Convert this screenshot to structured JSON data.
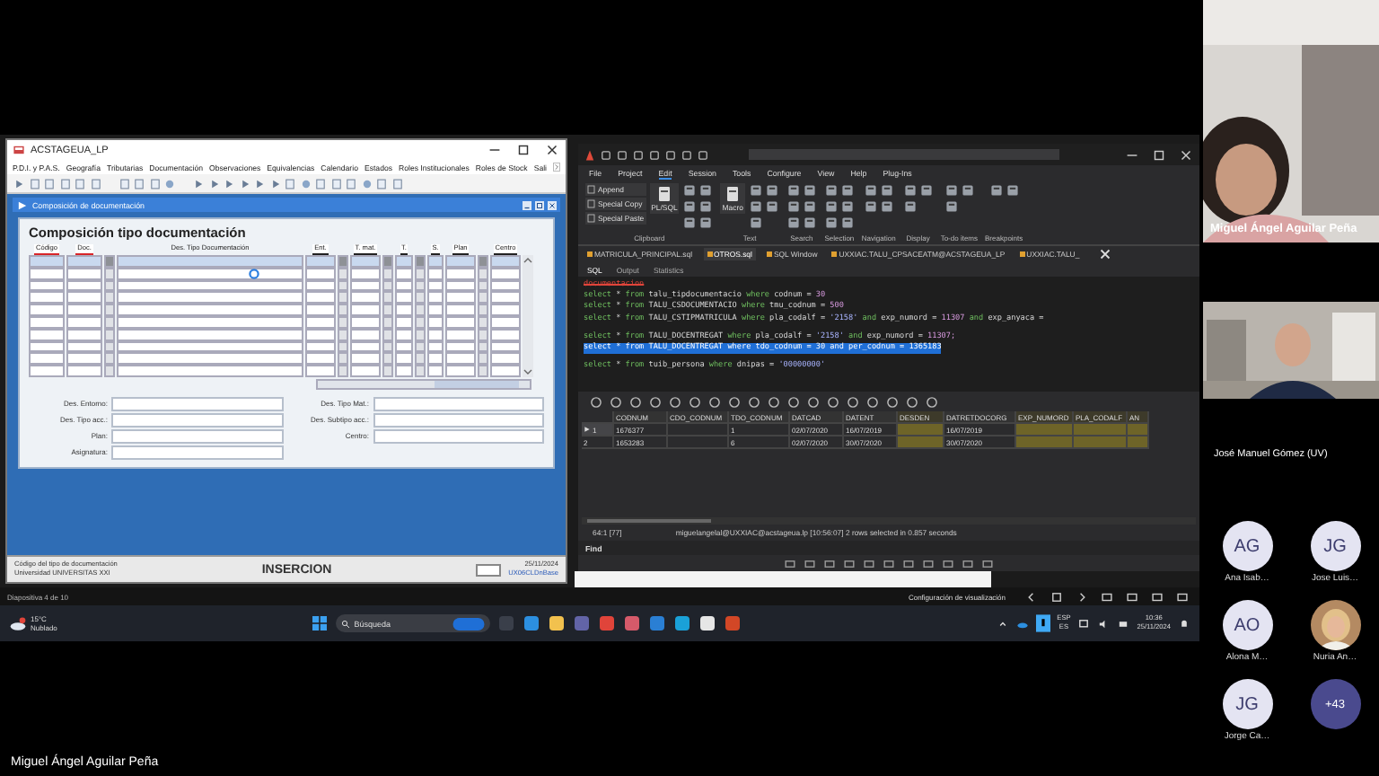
{
  "forms_window": {
    "title": "ACSTAGEUA_LP",
    "menu": [
      "P.D.I. y P.A.S.",
      "Geografía",
      "Tributarias",
      "Documentación",
      "Observaciones",
      "Equivalencias",
      "Calendario",
      "Estados",
      "Roles Institucionales",
      "Roles de Stock",
      "Sali"
    ],
    "form_title": "Composición de documentación",
    "heading": "Composición tipo documentación",
    "columns": [
      {
        "kind": "key",
        "label": "Código"
      },
      {
        "kind": "key",
        "label": "Doc."
      },
      {
        "kind": "flag"
      },
      {
        "kind": "desc",
        "label": "Des. Tipo Documentación"
      },
      {
        "kind": "field",
        "label": "Ent."
      },
      {
        "kind": "flag"
      },
      {
        "kind": "field",
        "label": "T. mat."
      },
      {
        "kind": "flag"
      },
      {
        "kind": "field",
        "label": "T."
      },
      {
        "kind": "flag"
      },
      {
        "kind": "field",
        "label": "S."
      },
      {
        "kind": "field",
        "label": "Plan"
      },
      {
        "kind": "flag"
      },
      {
        "kind": "field",
        "label": "Centro"
      }
    ],
    "fields": [
      {
        "label": "Des. Entorno:"
      },
      {
        "label": "Des. Tipo Mat.:"
      },
      {
        "label": "Des. Tipo acc.:"
      },
      {
        "label": "Des. Subtipo acc.:"
      },
      {
        "label": "Plan:"
      },
      {
        "label": "Centro:"
      },
      {
        "label": "Asignatura:"
      }
    ],
    "status": {
      "hint": "Código del tipo de documentación",
      "institution": "Universidad UNIVERSITAS XXI",
      "mode": "INSERCION",
      "date": "25/11/2024",
      "connection": "UX06CLDnBase"
    }
  },
  "sql_window": {
    "menu": [
      {
        "label": "File",
        "selected": false
      },
      {
        "label": "Project",
        "selected": false
      },
      {
        "label": "Edit",
        "selected": true
      },
      {
        "label": "Session",
        "selected": false
      },
      {
        "label": "Tools",
        "selected": false
      },
      {
        "label": "Configure",
        "selected": false
      },
      {
        "label": "View",
        "selected": false
      },
      {
        "label": "Help",
        "selected": false
      },
      {
        "label": "Plug-Ins",
        "selected": false
      }
    ],
    "ribbon": [
      {
        "label": "Clipboard",
        "buttons": [
          "Append",
          "Special Copy",
          "Special Paste"
        ],
        "big_button": "PL/SQL"
      },
      {
        "label": "Text",
        "big_button": "Macro"
      },
      {
        "label": "Search"
      },
      {
        "label": "Selection"
      },
      {
        "label": "Navigation"
      },
      {
        "label": "Display"
      },
      {
        "label": "To-do items"
      },
      {
        "label": "Breakpoints"
      }
    ],
    "tabs": [
      {
        "label": "MATRICULA_PRINCIPAL.sql",
        "selected": false
      },
      {
        "label": "OTROS.sql",
        "selected": true
      },
      {
        "label": "SQL Window",
        "selected": false
      },
      {
        "label": "UXXIAC.TALU_CPSACEATM@ACSTAGEUA_LP",
        "selected": false
      },
      {
        "label": "UXXIAC.TALU_",
        "selected": false
      }
    ],
    "subtabs": [
      {
        "label": "SQL",
        "selected": true
      },
      {
        "label": "Output",
        "selected": false
      },
      {
        "label": "Statistics",
        "selected": false
      }
    ],
    "editor_lines": [
      {
        "selected": false,
        "gap_before": false,
        "tokens": [
          {
            "kind": "comment",
            "text": "documentacion"
          }
        ]
      },
      {
        "selected": false,
        "gap_before": false,
        "tokens": [
          {
            "kind": "kw",
            "text": "select"
          },
          {
            "kind": "op",
            "text": "*"
          },
          {
            "kind": "kw",
            "text": "from"
          },
          {
            "kind": "id",
            "text": "talu_tipdocumentacio"
          },
          {
            "kind": "kw",
            "text": "where"
          },
          {
            "kind": "id",
            "text": "codnum"
          },
          {
            "kind": "op",
            "text": "="
          },
          {
            "kind": "num",
            "text": "30"
          }
        ]
      },
      {
        "selected": false,
        "gap_before": false,
        "tokens": [
          {
            "kind": "kw",
            "text": "select"
          },
          {
            "kind": "op",
            "text": "*"
          },
          {
            "kind": "kw",
            "text": "from"
          },
          {
            "kind": "id",
            "text": "TALU_CSDOCUMENTACIO"
          },
          {
            "kind": "kw",
            "text": "where"
          },
          {
            "kind": "id",
            "text": "tmu_codnum"
          },
          {
            "kind": "op",
            "text": "="
          },
          {
            "kind": "num",
            "text": "500"
          }
        ]
      },
      {
        "selected": false,
        "gap_before": false,
        "tokens": [
          {
            "kind": "kw",
            "text": "select"
          },
          {
            "kind": "op",
            "text": "*"
          },
          {
            "kind": "kw",
            "text": "from"
          },
          {
            "kind": "id",
            "text": "TALU_CSTIPMATRICULA"
          },
          {
            "kind": "kw",
            "text": "where"
          },
          {
            "kind": "id",
            "text": "pla_codalf"
          },
          {
            "kind": "op",
            "text": "="
          },
          {
            "kind": "str",
            "text": "'2158'"
          },
          {
            "kind": "kw",
            "text": "and"
          },
          {
            "kind": "id",
            "text": "exp_numord"
          },
          {
            "kind": "op",
            "text": "="
          },
          {
            "kind": "num",
            "text": "11307"
          },
          {
            "kind": "kw",
            "text": "and"
          },
          {
            "kind": "id",
            "text": "exp_anyaca"
          },
          {
            "kind": "op",
            "text": "="
          }
        ]
      },
      {
        "selected": false,
        "gap_before": true,
        "tokens": [
          {
            "kind": "kw",
            "text": "select"
          },
          {
            "kind": "op",
            "text": "*"
          },
          {
            "kind": "kw",
            "text": "from"
          },
          {
            "kind": "id",
            "text": "TALU_DOCENTREGAT"
          },
          {
            "kind": "kw",
            "text": "where"
          },
          {
            "kind": "id",
            "text": "pla_codalf"
          },
          {
            "kind": "op",
            "text": "="
          },
          {
            "kind": "str",
            "text": "'2158'"
          },
          {
            "kind": "kw",
            "text": "and"
          },
          {
            "kind": "id",
            "text": "exp_numord"
          },
          {
            "kind": "op",
            "text": "="
          },
          {
            "kind": "num",
            "text": "11307;"
          }
        ]
      },
      {
        "selected": true,
        "gap_before": false,
        "tokens": [
          {
            "kind": "kw",
            "text": "select"
          },
          {
            "kind": "op",
            "text": "*"
          },
          {
            "kind": "kw",
            "text": "from"
          },
          {
            "kind": "id",
            "text": "TALU_DOCENTREGAT"
          },
          {
            "kind": "kw",
            "text": "where"
          },
          {
            "kind": "id",
            "text": "tdo_codnum"
          },
          {
            "kind": "op",
            "text": "="
          },
          {
            "kind": "num",
            "text": "30"
          },
          {
            "kind": "kw",
            "text": "and"
          },
          {
            "kind": "id",
            "text": "per_codnum"
          },
          {
            "kind": "op",
            "text": "="
          },
          {
            "kind": "num",
            "text": "1365183"
          }
        ]
      },
      {
        "selected": false,
        "gap_before": true,
        "tokens": [
          {
            "kind": "kw",
            "text": "select"
          },
          {
            "kind": "op",
            "text": "*"
          },
          {
            "kind": "kw",
            "text": "from"
          },
          {
            "kind": "id",
            "text": "tuib_persona"
          },
          {
            "kind": "kw",
            "text": "where"
          },
          {
            "kind": "id",
            "text": "dnipas"
          },
          {
            "kind": "op",
            "text": "="
          },
          {
            "kind": "str",
            "text": "'00000000'"
          }
        ]
      }
    ],
    "results": {
      "columns": [
        {
          "label": "CODNUM",
          "highlighted": false
        },
        {
          "label": "CDO_CODNUM",
          "highlighted": false
        },
        {
          "label": "TDO_CODNUM",
          "highlighted": false
        },
        {
          "label": "DATCAD",
          "highlighted": false
        },
        {
          "label": "DATENT",
          "highlighted": false
        },
        {
          "label": "DESDEN",
          "highlighted": true
        },
        {
          "label": "DATRETDOCORG",
          "highlighted": false
        },
        {
          "label": "EXP_NUMORD",
          "highlighted": true
        },
        {
          "label": "PLA_CODALF",
          "highlighted": true
        },
        {
          "label": "AN",
          "highlighted": true
        }
      ],
      "rows": [
        {
          "number": "1",
          "selected": true,
          "cells": [
            "1676377",
            null,
            "1",
            "02/07/2020",
            "16/07/2019",
            null,
            "16/07/2019"
          ]
        },
        {
          "number": "2",
          "selected": false,
          "cells": [
            "1653283",
            null,
            "6",
            "02/07/2020",
            "30/07/2020",
            null,
            "30/07/2020"
          ]
        }
      ]
    },
    "status": {
      "position": "64:1 [77]",
      "message": "miguelangelal@UXXIAC@acstageua.lp [10:56:07] 2 rows selected in 0.857 seconds"
    },
    "find_label": "Find"
  },
  "presentation_bar": {
    "slide": "Diapositiva 4 de 10",
    "display_settings": "Configuración de visualización"
  },
  "taskbar": {
    "temperature": "15°C",
    "weather": "Nublado",
    "search_placeholder": "Búsqueda",
    "language": "ESP",
    "region": "ES",
    "time": "10:36",
    "date": "25/11/2024"
  },
  "call": {
    "speaker": "Miguel Ángel Aguilar Peña",
    "second_speaker": "José Manuel Gómez (UV)",
    "participants": [
      {
        "kind": "initials",
        "initials": "AG",
        "name": "Ana Isab…"
      },
      {
        "kind": "initials",
        "initials": "JG",
        "name": "Jose Luis…"
      },
      {
        "kind": "initials",
        "initials": "AO",
        "name": "Alona M…"
      },
      {
        "name": "Nuria An…"
      },
      {
        "kind": "initials",
        "initials": "JG",
        "name": "Jorge Ca…"
      },
      {
        "kind": "more",
        "count": "+43"
      }
    ],
    "presenter": "Miguel Ángel Aguilar Peña"
  }
}
